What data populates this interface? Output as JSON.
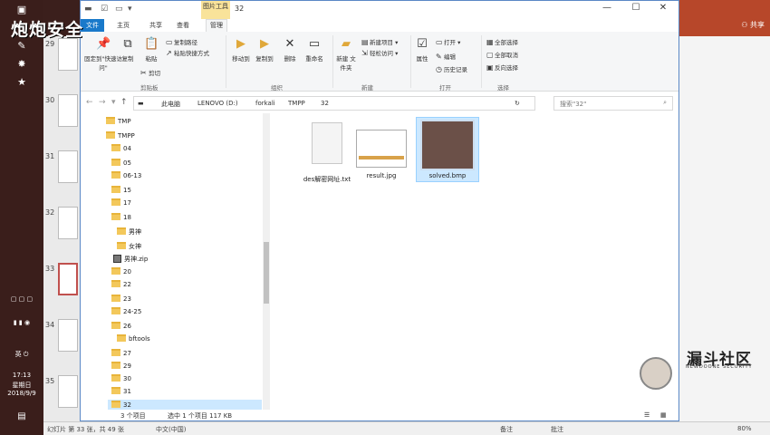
{
  "watermark": "炮炮安全",
  "tray": {
    "time": "17:13",
    "weekday": "星期日",
    "date": "2018/9/9",
    "ime": "英"
  },
  "slides": {
    "numbers": [
      "29",
      "30",
      "31",
      "32",
      "33",
      "34",
      "35"
    ],
    "selected": "33"
  },
  "ppt_right": {
    "share": "共享"
  },
  "logo": {
    "name": "漏斗社区",
    "sub": "NEWDOONE SECURITY"
  },
  "window": {
    "context_tab": "图片工具",
    "title": "32",
    "controls": {
      "minimize": "—",
      "maximize": "☐",
      "close": "✕"
    }
  },
  "tabs": {
    "file": "文件",
    "home": "主页",
    "share": "共享",
    "view": "查看",
    "manage": "管理"
  },
  "ribbon": {
    "clipboard": {
      "pin": "固定到\"快速访问\"",
      "copy": "复制",
      "paste": "粘贴",
      "cut": "剪切",
      "copy_path": "复制路径",
      "paste_shortcut": "粘贴快捷方式",
      "label": "剪贴板"
    },
    "organize": {
      "move_to": "移动到",
      "copy_to": "复制到",
      "delete": "删除",
      "rename": "重命名",
      "label": "组织"
    },
    "new": {
      "new_folder": "新建\n文件夹",
      "new_item": "新建项目 ▾",
      "easy_access": "轻松访问 ▾",
      "label": "新建"
    },
    "open": {
      "properties": "属性",
      "open": "打开 ▾",
      "edit": "编辑",
      "history": "历史记录",
      "label": "打开"
    },
    "select": {
      "select_all": "全部选择",
      "select_none": "全部取消",
      "invert": "反向选择",
      "label": "选择"
    }
  },
  "address": {
    "crumbs": [
      "此电脑",
      "LENOVO (D:)",
      "forkali",
      "TMPP",
      "32"
    ],
    "search_placeholder": "搜索\"32\""
  },
  "nav_tree": [
    "TMP",
    "TMPP",
    "04",
    "05",
    "06-13",
    "15",
    "17",
    "18",
    "男神",
    "女神",
    "男神.zip",
    "20",
    "22",
    "23",
    "24-25",
    "26",
    "bftools",
    "27",
    "29",
    "30",
    "31",
    "32"
  ],
  "files": [
    {
      "name": "des解密网址.txt"
    },
    {
      "name": "result.jpg"
    },
    {
      "name": "solved.bmp"
    }
  ],
  "status": {
    "count": "3 个项目",
    "selected": "选中 1 个项目  117 KB"
  },
  "pptbar": {
    "slide": "幻灯片 第 33 张，共 49 张",
    "lang": "中文(中国)",
    "notes": "备注",
    "comments": "批注",
    "zoom": "80%"
  }
}
